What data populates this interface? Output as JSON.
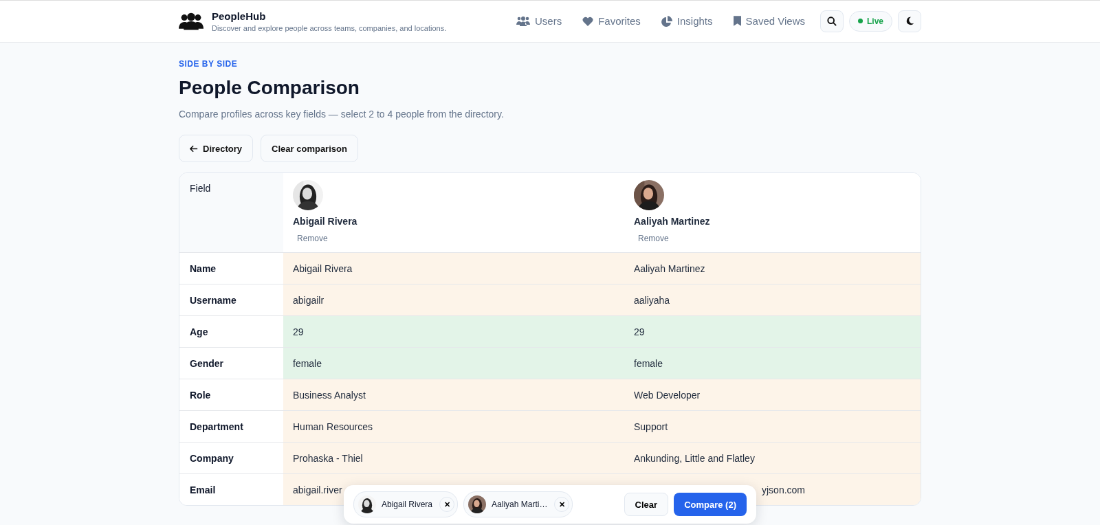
{
  "brand": {
    "name": "PeopleHub",
    "tagline": "Discover and explore people across teams, companies, and locations."
  },
  "nav": [
    {
      "label": "Users"
    },
    {
      "label": "Favorites"
    },
    {
      "label": "Insights"
    },
    {
      "label": "Saved Views"
    }
  ],
  "status": {
    "label": "Live",
    "on": true
  },
  "eyebrow": "SIDE BY SIDE",
  "title": "People Comparison",
  "subtitle": "Compare profiles across key fields — select 2 to 4 people from the directory.",
  "actions": [
    {
      "label": "Directory"
    },
    {
      "label": "Clear comparison"
    }
  ],
  "table": {
    "field_header": "Field",
    "people": [
      {
        "name": "Abigail Rivera",
        "remove": "Remove"
      },
      {
        "name": "Aaliyah Martinez",
        "remove": "Remove"
      }
    ],
    "rows": [
      {
        "field": "Name",
        "match": false,
        "values": [
          "Abigail Rivera",
          "Aaliyah Martinez"
        ]
      },
      {
        "field": "Username",
        "match": false,
        "values": [
          "abigailr",
          "aaliyaha"
        ]
      },
      {
        "field": "Age",
        "match": true,
        "values": [
          "29",
          "29"
        ]
      },
      {
        "field": "Gender",
        "match": true,
        "values": [
          "female",
          "female"
        ]
      },
      {
        "field": "Role",
        "match": false,
        "values": [
          "Business Analyst",
          "Web Developer"
        ]
      },
      {
        "field": "Department",
        "match": false,
        "values": [
          "Human Resources",
          "Support"
        ]
      },
      {
        "field": "Company",
        "match": false,
        "values": [
          "Prohaska - Thiel",
          "Ankunding, Little and Flatley"
        ]
      },
      {
        "field": "Email",
        "match": false,
        "kind": "covered",
        "values": [
          "abigail.river",
          "yjson.com"
        ]
      }
    ]
  },
  "tray": {
    "chips": [
      {
        "name": "Abigail Rivera"
      },
      {
        "name": "Aaliyah Marti…"
      }
    ],
    "close": "✕",
    "clear": "Clear",
    "compare": "Compare (2)"
  }
}
